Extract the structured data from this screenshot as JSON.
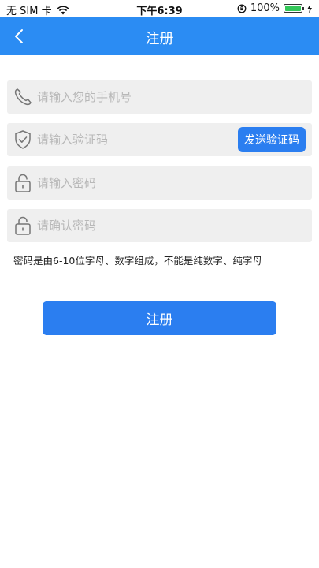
{
  "status_bar": {
    "carrier": "无 SIM 卡",
    "time": "下午6:39",
    "battery": "100%",
    "battery_level": 1.0
  },
  "nav": {
    "title": "注册"
  },
  "form": {
    "phone_placeholder": "请输入您的手机号",
    "code_placeholder": "请输入验证码",
    "send_code_label": "发送验证码",
    "password_placeholder": "请输入密码",
    "confirm_placeholder": "请确认密码",
    "hint": "密码是由6-10位字母、数字组成，不能是纯数字、纯字母",
    "submit_label": "注册"
  },
  "colors": {
    "nav_bg": "#2b8cf3",
    "button_bg": "#2b7ef0",
    "field_bg": "#efefef"
  }
}
